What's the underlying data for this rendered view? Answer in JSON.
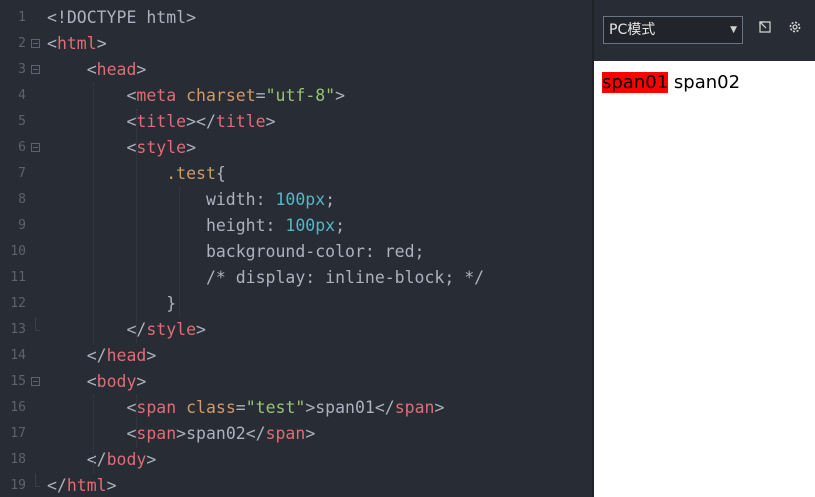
{
  "editor": {
    "lines": [
      {
        "num": "1",
        "tokens": [
          {
            "t": "<!DOCTYPE html>",
            "c": "#abb2bf"
          }
        ]
      },
      {
        "num": "2",
        "tokens": [
          {
            "t": "<",
            "c": "#abb2bf"
          },
          {
            "t": "html",
            "c": "#e06c75"
          },
          {
            "t": ">",
            "c": "#abb2bf"
          }
        ]
      },
      {
        "num": "3",
        "tokens": [
          {
            "t": "    <",
            "c": "#abb2bf"
          },
          {
            "t": "head",
            "c": "#e06c75"
          },
          {
            "t": ">",
            "c": "#abb2bf"
          }
        ]
      },
      {
        "num": "4",
        "tokens": [
          {
            "t": "        <",
            "c": "#abb2bf"
          },
          {
            "t": "meta",
            "c": "#e06c75"
          },
          {
            "t": " ",
            "c": "#abb2bf"
          },
          {
            "t": "charset",
            "c": "#d19a66"
          },
          {
            "t": "=",
            "c": "#abb2bf"
          },
          {
            "t": "\"utf-8\"",
            "c": "#98c379"
          },
          {
            "t": ">",
            "c": "#abb2bf"
          }
        ]
      },
      {
        "num": "5",
        "tokens": [
          {
            "t": "        <",
            "c": "#abb2bf"
          },
          {
            "t": "title",
            "c": "#e06c75"
          },
          {
            "t": "></",
            "c": "#abb2bf"
          },
          {
            "t": "title",
            "c": "#e06c75"
          },
          {
            "t": ">",
            "c": "#abb2bf"
          }
        ]
      },
      {
        "num": "6",
        "tokens": [
          {
            "t": "        <",
            "c": "#abb2bf"
          },
          {
            "t": "style",
            "c": "#e06c75"
          },
          {
            "t": ">",
            "c": "#abb2bf"
          }
        ]
      },
      {
        "num": "7",
        "tokens": [
          {
            "t": "            ",
            "c": "#abb2bf"
          },
          {
            "t": ".test",
            "c": "#d19a66"
          },
          {
            "t": "{",
            "c": "#abb2bf"
          }
        ]
      },
      {
        "num": "8",
        "tokens": [
          {
            "t": "                width: ",
            "c": "#abb2bf"
          },
          {
            "t": "100px",
            "c": "#56b6c2"
          },
          {
            "t": ";",
            "c": "#abb2bf"
          }
        ]
      },
      {
        "num": "9",
        "tokens": [
          {
            "t": "                height: ",
            "c": "#abb2bf"
          },
          {
            "t": "100px",
            "c": "#56b6c2"
          },
          {
            "t": ";",
            "c": "#abb2bf"
          }
        ]
      },
      {
        "num": "10",
        "tokens": [
          {
            "t": "                background-color: red;",
            "c": "#abb2bf"
          }
        ]
      },
      {
        "num": "11",
        "tokens": [
          {
            "t": "                /* display: inline-block; */",
            "c": "#abb2bf"
          }
        ]
      },
      {
        "num": "12",
        "tokens": [
          {
            "t": "            }",
            "c": "#abb2bf"
          }
        ]
      },
      {
        "num": "13",
        "tokens": [
          {
            "t": "        </",
            "c": "#abb2bf"
          },
          {
            "t": "style",
            "c": "#e06c75"
          },
          {
            "t": ">",
            "c": "#abb2bf"
          }
        ]
      },
      {
        "num": "14",
        "tokens": [
          {
            "t": "    </",
            "c": "#abb2bf"
          },
          {
            "t": "head",
            "c": "#e06c75"
          },
          {
            "t": ">",
            "c": "#abb2bf"
          }
        ]
      },
      {
        "num": "15",
        "tokens": [
          {
            "t": "    <",
            "c": "#abb2bf"
          },
          {
            "t": "body",
            "c": "#e06c75"
          },
          {
            "t": ">",
            "c": "#abb2bf"
          }
        ]
      },
      {
        "num": "16",
        "tokens": [
          {
            "t": "        <",
            "c": "#abb2bf"
          },
          {
            "t": "span",
            "c": "#e06c75"
          },
          {
            "t": " ",
            "c": "#abb2bf"
          },
          {
            "t": "class",
            "c": "#d19a66"
          },
          {
            "t": "=",
            "c": "#abb2bf"
          },
          {
            "t": "\"test\"",
            "c": "#98c379"
          },
          {
            "t": ">span01</",
            "c": "#abb2bf"
          },
          {
            "t": "span",
            "c": "#e06c75"
          },
          {
            "t": ">",
            "c": "#abb2bf"
          }
        ]
      },
      {
        "num": "17",
        "tokens": [
          {
            "t": "        <",
            "c": "#abb2bf"
          },
          {
            "t": "span",
            "c": "#e06c75"
          },
          {
            "t": ">span02</",
            "c": "#abb2bf"
          },
          {
            "t": "span",
            "c": "#e06c75"
          },
          {
            "t": ">",
            "c": "#abb2bf"
          }
        ]
      },
      {
        "num": "18",
        "tokens": [
          {
            "t": "    </",
            "c": "#abb2bf"
          },
          {
            "t": "body",
            "c": "#e06c75"
          },
          {
            "t": ">",
            "c": "#abb2bf"
          }
        ]
      },
      {
        "num": "19",
        "tokens": [
          {
            "t": "</",
            "c": "#abb2bf"
          },
          {
            "t": "html",
            "c": "#e06c75"
          },
          {
            "t": ">",
            "c": "#abb2bf"
          }
        ]
      }
    ]
  },
  "preview": {
    "mode_select": "PC模式",
    "open_icon": "open-external-icon",
    "settings_icon": "gear-icon",
    "span01": "span01",
    "span02": "span02",
    "span01_bg": "#ff0000"
  }
}
